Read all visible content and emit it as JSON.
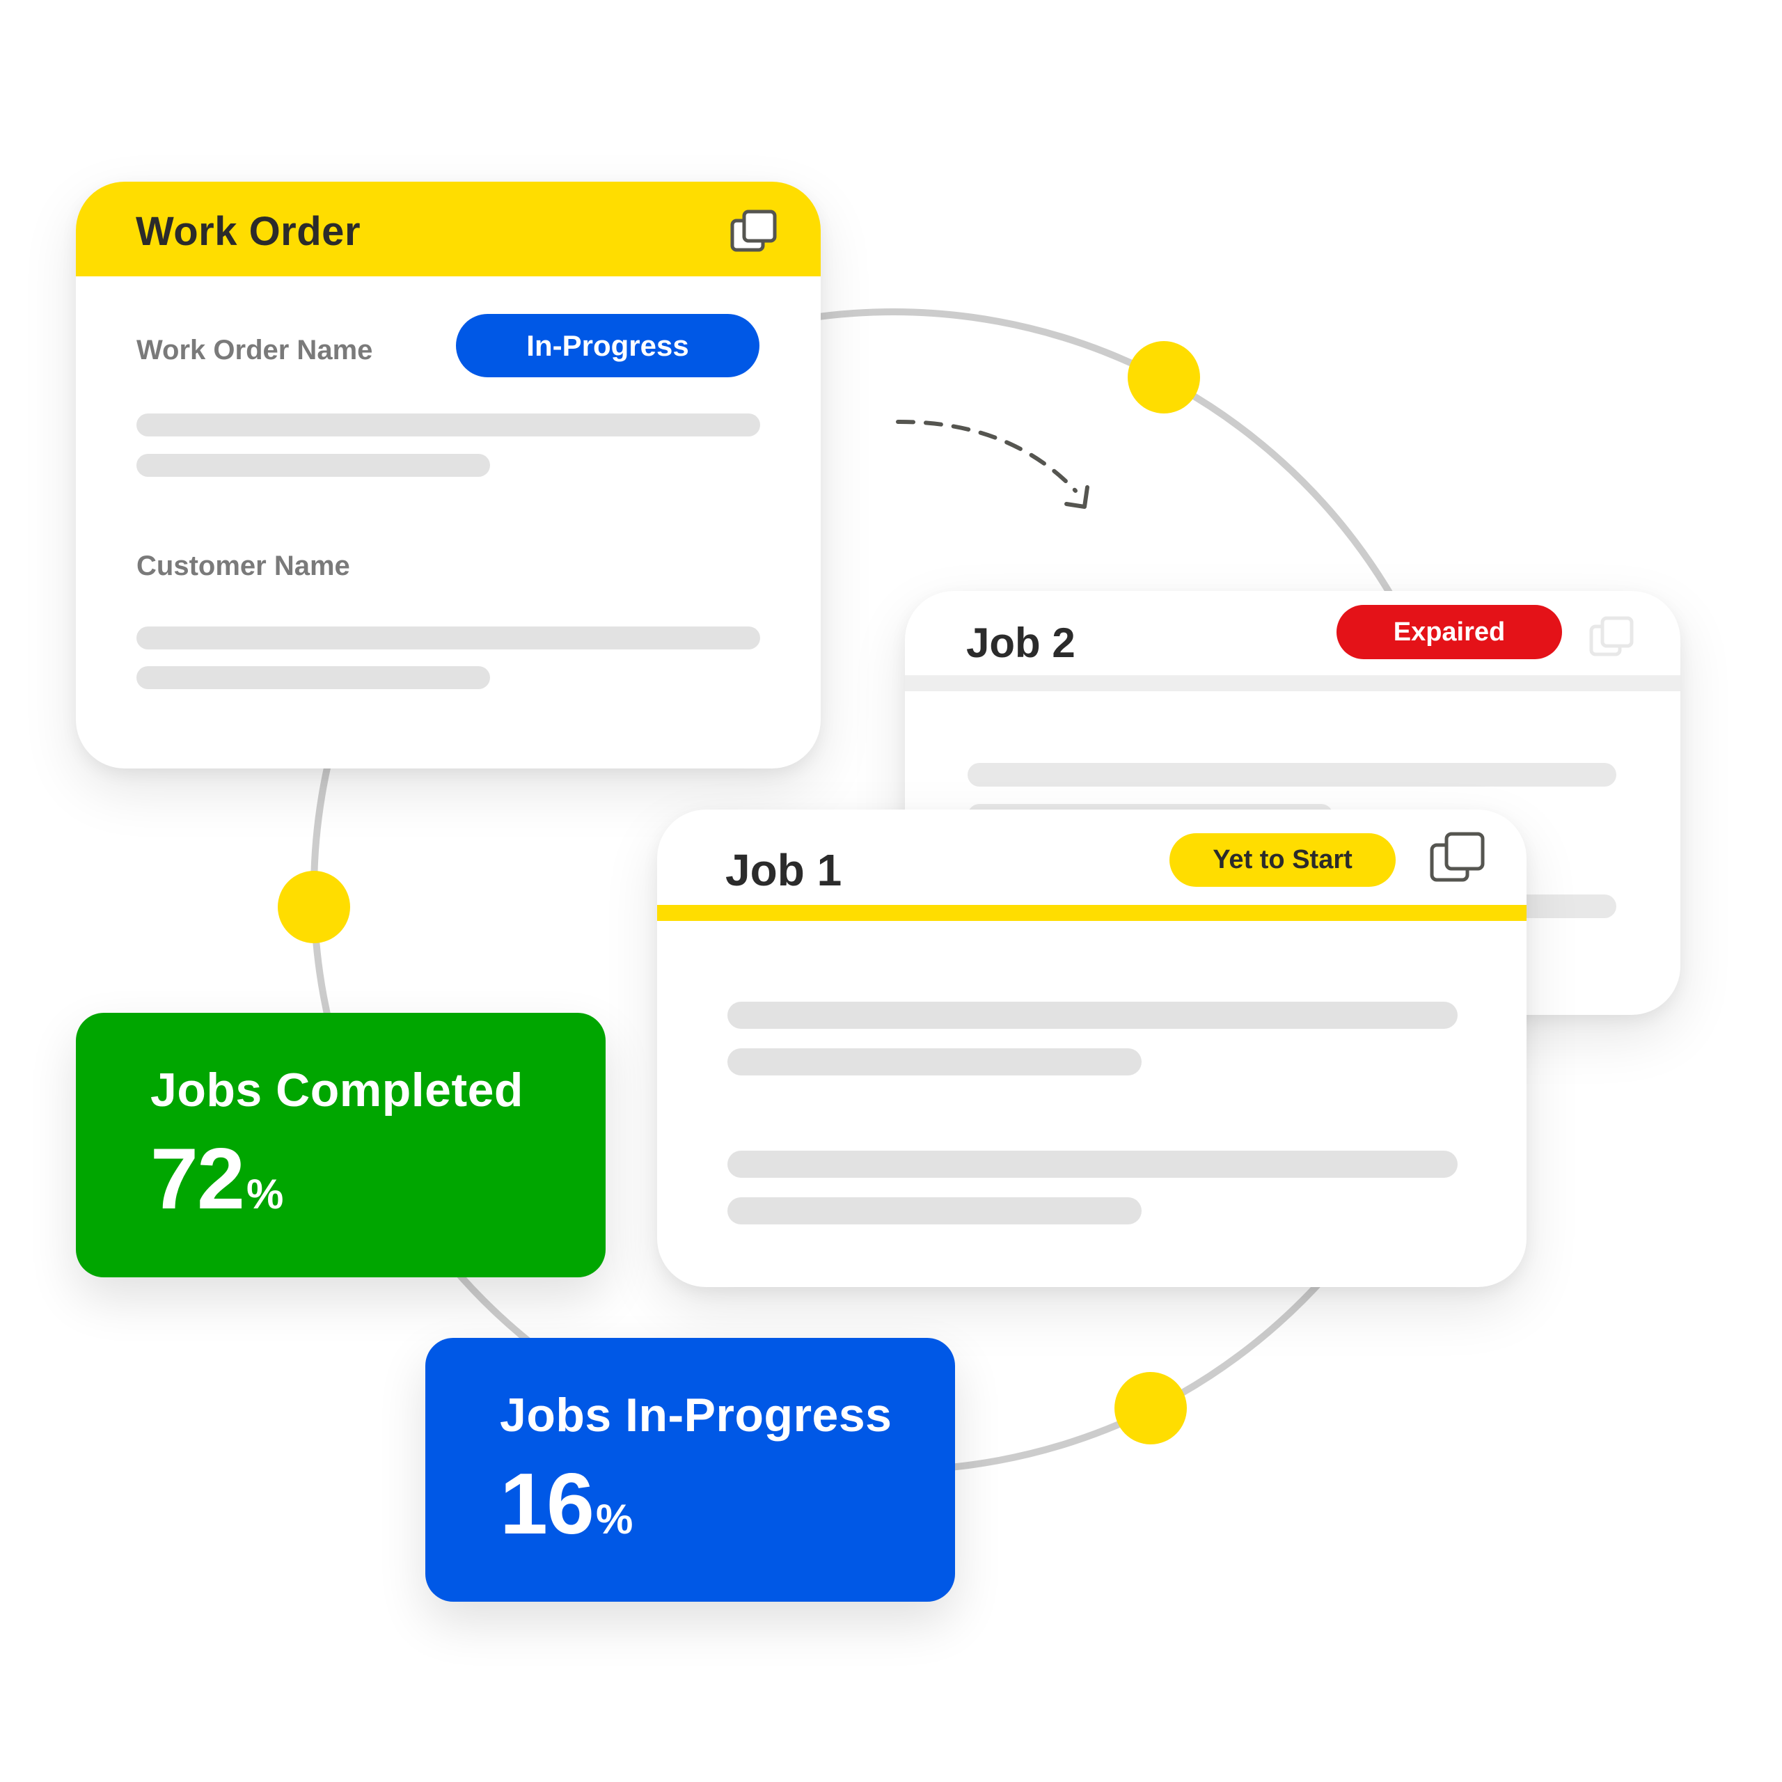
{
  "work_order": {
    "title": "Work Order",
    "copy_icon": "copy-icon",
    "fields": [
      {
        "label": "Work Order Name"
      },
      {
        "label": "Customer Name"
      }
    ],
    "status": "In-Progress"
  },
  "jobs": [
    {
      "title": "Job 2",
      "status": "Expaired",
      "copy_icon": "copy-icon"
    },
    {
      "title": "Job 1",
      "status": "Yet to Start",
      "copy_icon": "copy-icon"
    }
  ],
  "stats": [
    {
      "label": "Jobs Completed",
      "value": "72",
      "unit": "%"
    },
    {
      "label": "Jobs In-Progress",
      "value": "16",
      "unit": "%"
    }
  ],
  "colors": {
    "brand_yellow": "#ffdd00",
    "in_progress_blue": "#0058e6",
    "expired_red": "#e41218",
    "completed_green": "#00a600",
    "connector_gray": "#cccccc",
    "text_dark": "#2b2b2b",
    "label_gray": "#7a7a7a",
    "skeleton_gray": "#e2e2e2"
  }
}
